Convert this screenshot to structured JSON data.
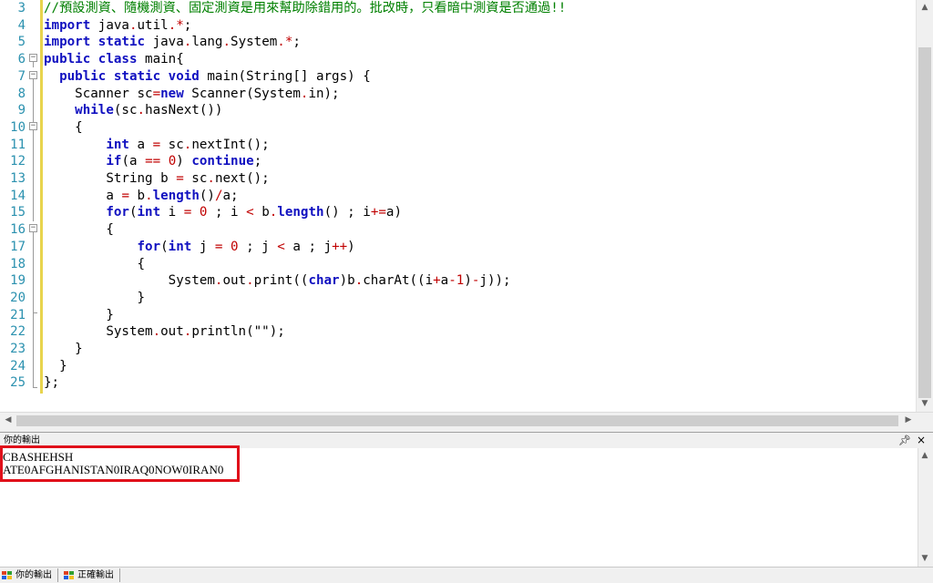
{
  "editor": {
    "line_numbers": [
      "3",
      "4",
      "5",
      "6",
      "7",
      "8",
      "9",
      "10",
      "11",
      "12",
      "13",
      "14",
      "15",
      "16",
      "17",
      "18",
      "19",
      "20",
      "21",
      "22",
      "23",
      "24",
      "25"
    ]
  },
  "code": {
    "l3": "//預設測資、隨機測資、固定測資是用來幫助除錯用的。批改時，只看暗中測資是否通過!!",
    "l4_kw": "import",
    "l4_a": " java",
    "l4_dot": ".",
    "l4_b": "util",
    "l4_star": ".*;",
    "l5_kw": "import static",
    "l5_a": " java",
    "l5_b": "lang",
    "l5_c": "System",
    "l6_kw": "public class",
    "l6_rest": " main{",
    "l7_kw": "public static void",
    "l7_rest": " main(String[] args) {",
    "l8_a": "Scanner sc",
    "l8_eq": "=",
    "l8_kw": "new",
    "l8_b": " Scanner(System",
    "l8_c": "in);",
    "l9_kw": "while",
    "l9_a": "(sc",
    "l9_b": "hasNext())",
    "l10": "{",
    "l11_kw": "int",
    "l11_a": " a ",
    "l11_b": " sc",
    "l11_c": "nextInt();",
    "l12_kw": "if",
    "l12_a": "(a ",
    "l12_eq": "==",
    "l12_num": "0",
    "l12_b": ") ",
    "l12_kw2": "continue",
    "l12_c": ";",
    "l13_a": "String b ",
    "l13_b": " sc",
    "l13_c": "next();",
    "l14_a": "a ",
    "l14_b": " b",
    "l14_kw": "length",
    "l14_c": "()",
    "l14_d": "a;",
    "l15_kw": "for",
    "l15_kw2": "int",
    "l15_a": " i ",
    "l15_num": "0",
    "l15_b": " ; i ",
    "l15_c": " b",
    "l15_kw3": "length",
    "l15_d": "() ; i",
    "l15_e": "a)",
    "l16": "{",
    "l17_kw": "for",
    "l17_kw2": "int",
    "l17_a": " j ",
    "l17_num": "0",
    "l17_b": " ; j ",
    "l17_c": " a ; j",
    "l17_d": ")",
    "l18": "{",
    "l19_a": "System",
    "l19_b": "out",
    "l19_c": "print((",
    "l19_kw": "char",
    "l19_d": ")b",
    "l19_e": "charAt((i",
    "l19_f": "a",
    "l19_num": "1",
    "l19_g": ")",
    "l19_h": "j));",
    "l20": "}",
    "l21": "}",
    "l22_a": "System",
    "l22_b": "out",
    "l22_c": "println(\"\");",
    "l23": "}",
    "l24": "}",
    "l25": "};"
  },
  "panel": {
    "title": "你的輸出",
    "pin": "ᅟ",
    "close": "×"
  },
  "output": {
    "line1": "CBASHEHSH",
    "line2": "ATE0AFGHANISTAN0IRAQ0NOW0IRAN0"
  },
  "tabs": [
    {
      "label": "你的輸出"
    },
    {
      "label": "正確輸出"
    }
  ],
  "colors": {
    "keyword": "#1010c0",
    "operator": "#c00000",
    "comment": "#008000",
    "highlight_box": "#e0101a",
    "line_number": "#2b91af"
  }
}
